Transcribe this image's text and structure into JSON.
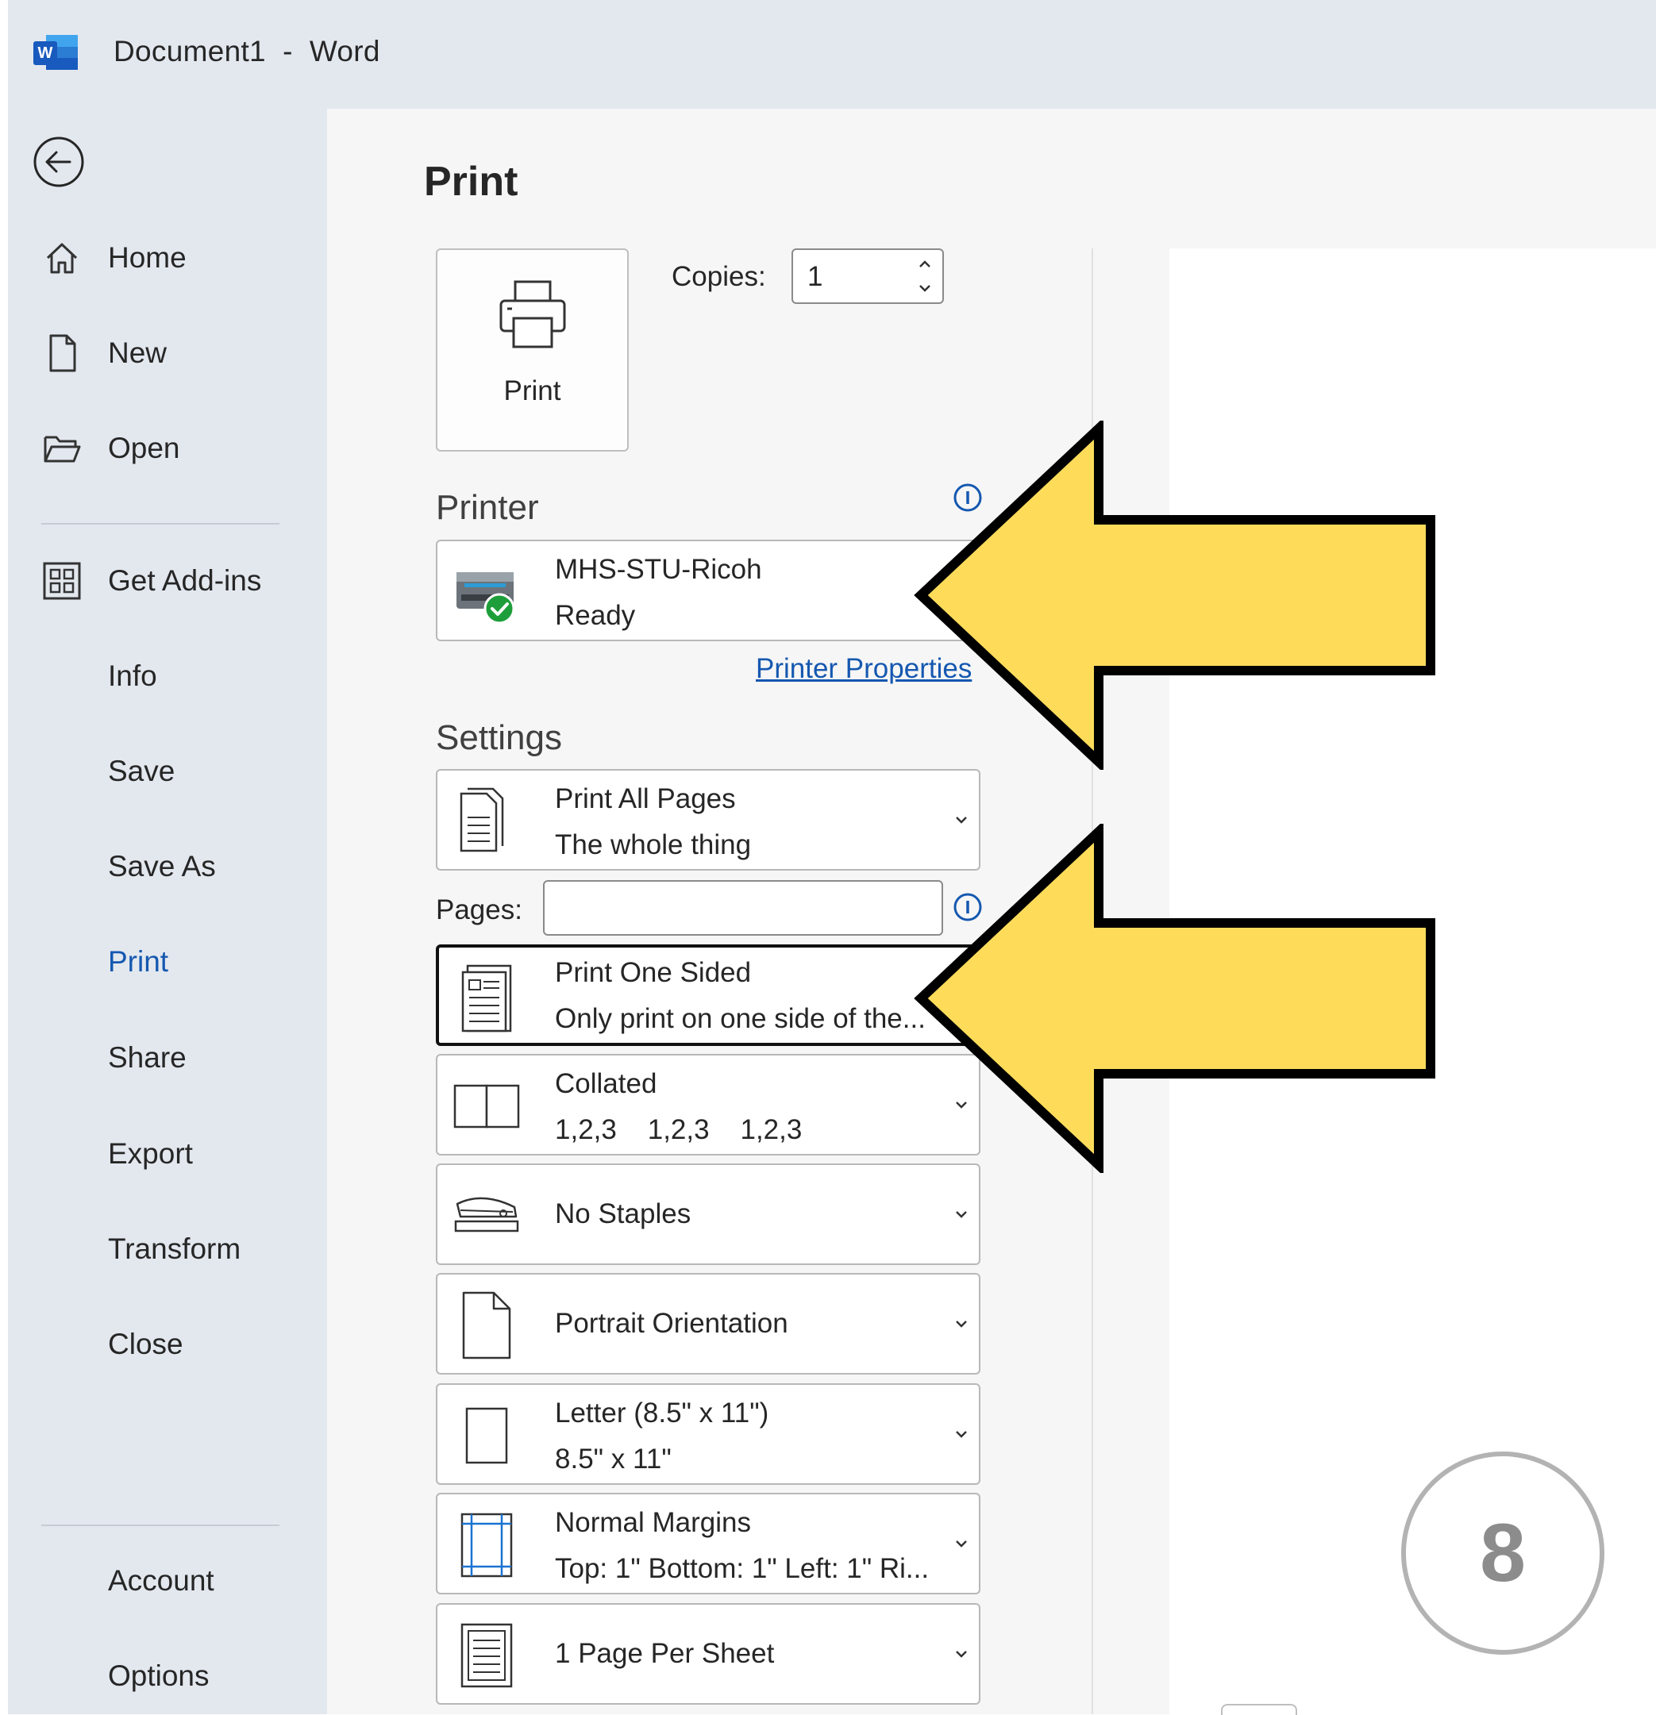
{
  "window": {
    "title": "Document1  -  Word",
    "app_icon": "word-logo"
  },
  "nav": {
    "back_icon": "back-arrow-icon",
    "items": [
      {
        "label": "Home",
        "icon": "home-icon"
      },
      {
        "label": "New",
        "icon": "new-document-icon"
      },
      {
        "label": "Open",
        "icon": "folder-open-icon"
      },
      {
        "label": "Get Add-ins",
        "icon": "grid-addins-icon"
      },
      {
        "label": "Info"
      },
      {
        "label": "Save"
      },
      {
        "label": "Save As"
      },
      {
        "label": "Print",
        "active": true
      },
      {
        "label": "Share"
      },
      {
        "label": "Export"
      },
      {
        "label": "Transform"
      },
      {
        "label": "Close"
      },
      {
        "label": "Account"
      },
      {
        "label": "Options"
      }
    ]
  },
  "print": {
    "heading": "Print",
    "button_label": "Print",
    "copies_label": "Copies:",
    "copies_value": "1"
  },
  "printer": {
    "section_label": "Printer",
    "name": "MHS-STU-Ricoh",
    "status": "Ready",
    "properties_link": "Printer Properties"
  },
  "settings": {
    "section_label": "Settings",
    "pages_label": "Pages:",
    "pages_value": "",
    "options": [
      {
        "main": "Print All Pages",
        "sub": "The whole thing",
        "icon": "pages-icon"
      },
      {
        "main": "Print One Sided",
        "sub": "Only print on one side of the...",
        "icon": "one-sided-icon",
        "focused": true
      },
      {
        "main": "Collated",
        "sub": "1,2,3    1,2,3    1,2,3",
        "icon": "collated-icon"
      },
      {
        "main": "No Staples",
        "icon": "stapler-icon"
      },
      {
        "main": "Portrait Orientation",
        "icon": "portrait-icon"
      },
      {
        "main": "Letter (8.5\" x 11\")",
        "sub": "8.5\" x 11\"",
        "icon": "paper-size-icon"
      },
      {
        "main": "Normal Margins",
        "sub": "Top: 1\" Bottom: 1\" Left: 1\" Ri...",
        "icon": "margins-icon"
      },
      {
        "main": "1 Page Per Sheet",
        "icon": "page-per-sheet-icon"
      }
    ]
  },
  "annotations": {
    "arrow_color": "#fedc5a",
    "step_number": "8"
  },
  "colors": {
    "nav_bg": "#e3e8ef",
    "content_bg": "#f6f6f6",
    "accent": "#1558b0",
    "ready_green": "#1e9e3a"
  }
}
